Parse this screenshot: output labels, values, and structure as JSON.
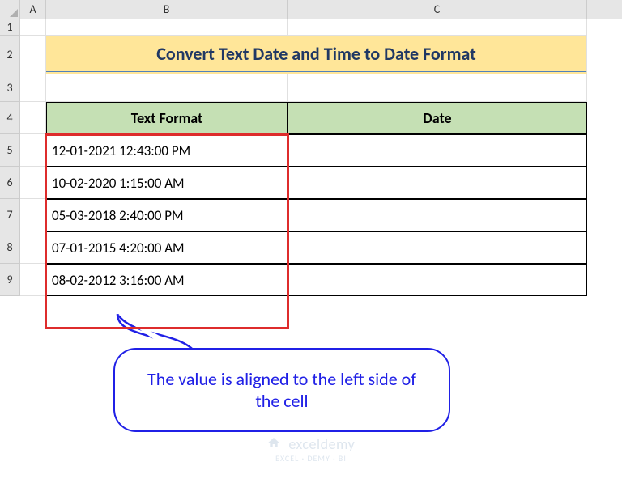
{
  "columns": {
    "A": "A",
    "B": "B",
    "C": "C"
  },
  "rows": {
    "r1": "1",
    "r2": "2",
    "r3": "3",
    "r4": "4",
    "r5": "5",
    "r6": "6",
    "r7": "7",
    "r8": "8",
    "r9": "9"
  },
  "title": "Convert Text Date and Time to Date Format",
  "headers": {
    "text_format": "Text Format",
    "date": "Date"
  },
  "data": {
    "r5": "12-01-2021  12:43:00 PM",
    "r6": "10-02-2020  1:15:00 AM",
    "r7": "05-03-2018  2:40:00 PM",
    "r8": "07-01-2015  4:20:00 AM",
    "r9": "08-02-2012  3:16:00 AM"
  },
  "callout": "The value is aligned to the left side of the cell",
  "watermark": {
    "brand": "exceldemy",
    "sub": "EXCEL · DEMY · BI"
  }
}
